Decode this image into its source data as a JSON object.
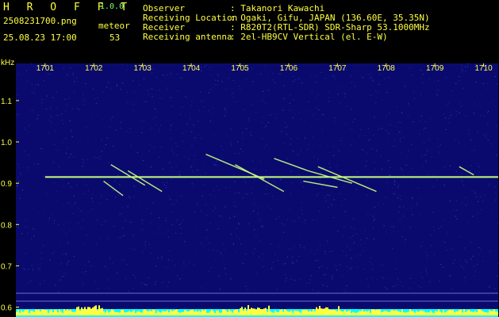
{
  "header": {
    "app_name": "H R O F F T",
    "version": "1.0.0",
    "filename": "2508231700.png",
    "datetime": "25.08.23 17:00",
    "meteor_label": "meteor",
    "meteor_count": "53",
    "observer_label": "Observer",
    "observer_value": ": Takanori Kawachi",
    "location_label": "Receiving Location",
    "location_value": ": Ogaki, Gifu, JAPAN (136.60E, 35.35N)",
    "receiver_label": "Receiver",
    "receiver_value": ": R820T2(RTL-SDR) SDR-Sharp 53.1000MHz",
    "antenna_label": "Receiving antenna",
    "antenna_value": ": 2el-HB9CV Vertical (el. E-W)"
  },
  "colors": {
    "header_text": "#ffff40",
    "version_text": "#7cff7c",
    "axis_text": "#ffff40",
    "background": "#0a0a6e",
    "noise_band": "#00ffff",
    "signal": "#c8ff80"
  },
  "chart_data": {
    "type": "heatmap",
    "ylabel": "kHz",
    "yticks": [
      "1.1",
      "1.0",
      "0.9",
      "0.8",
      "0.7",
      "0.6"
    ],
    "ytick_values": [
      1.1,
      1.0,
      0.9,
      0.8,
      0.7,
      0.6
    ],
    "ylim": [
      0.58,
      1.19
    ],
    "xticks": [
      "1701",
      "1702",
      "1703",
      "1704",
      "1705",
      "1706",
      "1707",
      "1708",
      "1709",
      "1710"
    ],
    "xtick_values": [
      1701,
      1702,
      1703,
      1704,
      1705,
      1706,
      1707,
      1708,
      1709,
      1710
    ],
    "xlim": [
      1700.4,
      1710.3
    ],
    "carrier_khz": 0.915,
    "meteor_echoes": [
      {
        "t0": 1702.35,
        "t1": 1703.05,
        "f0": 0.945,
        "f1": 0.895
      },
      {
        "t0": 1702.7,
        "t1": 1703.4,
        "f0": 0.93,
        "f1": 0.88
      },
      {
        "t0": 1702.2,
        "t1": 1702.6,
        "f0": 0.905,
        "f1": 0.87
      },
      {
        "t0": 1704.3,
        "t1": 1705.5,
        "f0": 0.97,
        "f1": 0.91
      },
      {
        "t0": 1704.9,
        "t1": 1705.9,
        "f0": 0.945,
        "f1": 0.88
      },
      {
        "t0": 1705.7,
        "t1": 1706.4,
        "f0": 0.96,
        "f1": 0.93
      },
      {
        "t0": 1706.4,
        "t1": 1707.3,
        "f0": 0.93,
        "f1": 0.9
      },
      {
        "t0": 1706.6,
        "t1": 1707.8,
        "f0": 0.94,
        "f1": 0.88
      },
      {
        "t0": 1706.3,
        "t1": 1707.0,
        "f0": 0.905,
        "f1": 0.89
      },
      {
        "t0": 1709.5,
        "t1": 1709.8,
        "f0": 0.94,
        "f1": 0.92
      }
    ]
  }
}
